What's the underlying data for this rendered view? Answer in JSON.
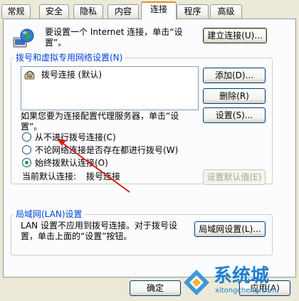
{
  "tabs": [
    {
      "label": "常规"
    },
    {
      "label": "安全"
    },
    {
      "label": "隐私"
    },
    {
      "label": "内容"
    },
    {
      "label": "连接"
    },
    {
      "label": "程序"
    },
    {
      "label": "高级"
    }
  ],
  "active_tab": "连接",
  "internet": {
    "line1": "要设置一个 Internet 连接，单击“设",
    "line2": "置”。",
    "setup_button": "建立连接(U)..."
  },
  "dialup": {
    "legend": "拨号和虚拟专用网络设置(N)",
    "connections": [
      {
        "label": "拨号连接 (默认)"
      }
    ],
    "add_button": "添加(D)...",
    "remove_button": "删除(R)",
    "proxy_line1": "如果您要为连接配置代理服务器，单击“设",
    "proxy_line2": "置”。",
    "settings_button": "设置(S)...",
    "options": [
      {
        "label": "从不进行拨号连接(C)",
        "checked": false
      },
      {
        "label": "不论网络连接是否存在都进行拨号(W)",
        "checked": false
      },
      {
        "label": "始终拨默认连接(O)",
        "checked": true
      }
    ],
    "current_default_label": "当前默认连接:",
    "current_default_value": "拨号连接",
    "set_default_button": "设置默认值(E)"
  },
  "lan": {
    "legend": "局域网(LAN)设置",
    "line1": "LAN 设置不应用到拨号连接。对于拨号设",
    "line2": "置，单击上面的“设置”按钮。",
    "lan_button": "局域网设置(L)..."
  },
  "footer": {
    "ok_button": "确定",
    "apply_button": "应用(A)"
  },
  "watermark": {
    "brand": "系统城",
    "url": "xitongcheng.com"
  },
  "colors": {
    "legend": "#0046d5",
    "arrow": "#d42020",
    "active_tab_accent": "#e68b2c"
  }
}
